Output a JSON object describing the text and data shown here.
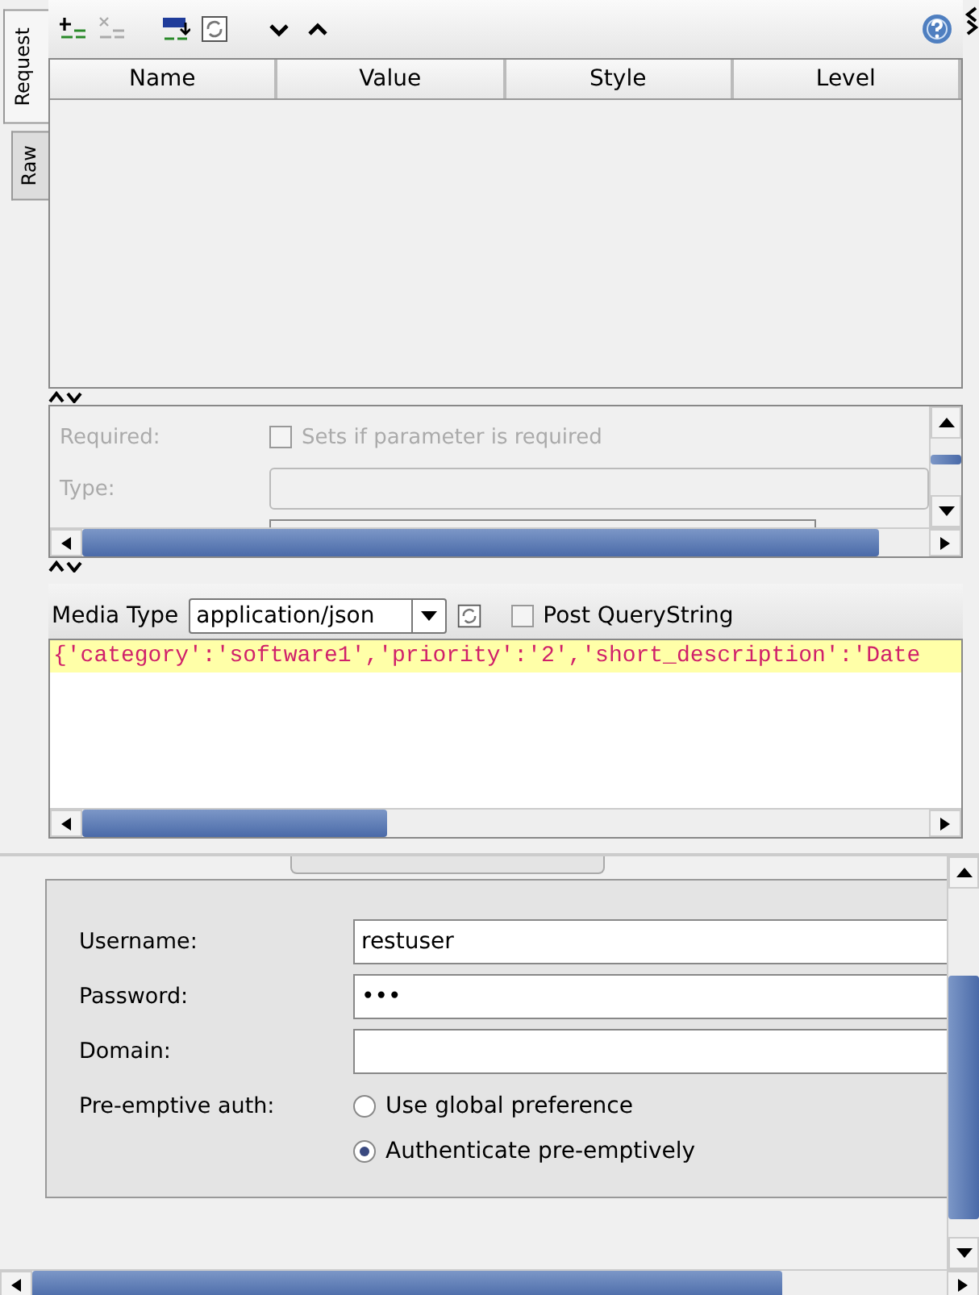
{
  "side_tabs": [
    {
      "label": "Request",
      "selected": true
    },
    {
      "label": "Raw",
      "selected": false
    }
  ],
  "toolbar_buttons": [
    {
      "kind": "add",
      "disabled": false
    },
    {
      "kind": "remove",
      "disabled": true
    },
    {
      "kind": "url",
      "disabled": false
    },
    {
      "kind": "refresh",
      "disabled": false
    },
    {
      "kind": "down",
      "disabled": false
    },
    {
      "kind": "up",
      "disabled": false
    }
  ],
  "table": {
    "columns": [
      "Name",
      "Value",
      "Style",
      "Level"
    ]
  },
  "parameter_details": {
    "required_label": "Required:",
    "required_checkbox": {
      "label": "Sets if parameter is required",
      "checked": false
    },
    "type_label": "Type:"
  },
  "media_type": {
    "label": "Media Type",
    "value": "application/json"
  },
  "post_query_string": {
    "label": "Post QueryString",
    "checked": false
  },
  "body": "{'category':'software1','priority':'2','short_description':'Date",
  "auth": {
    "fields": [
      {
        "label": "Username:",
        "value": "restuser"
      },
      {
        "label": "Password:",
        "value": "•••"
      },
      {
        "label": "Domain:"
      }
    ],
    "preemptive_label": "Pre-emptive auth:",
    "options": [
      {
        "label": "Use global preference",
        "selected": false
      },
      {
        "label": "Authenticate pre-emptively",
        "selected": true
      }
    ]
  }
}
